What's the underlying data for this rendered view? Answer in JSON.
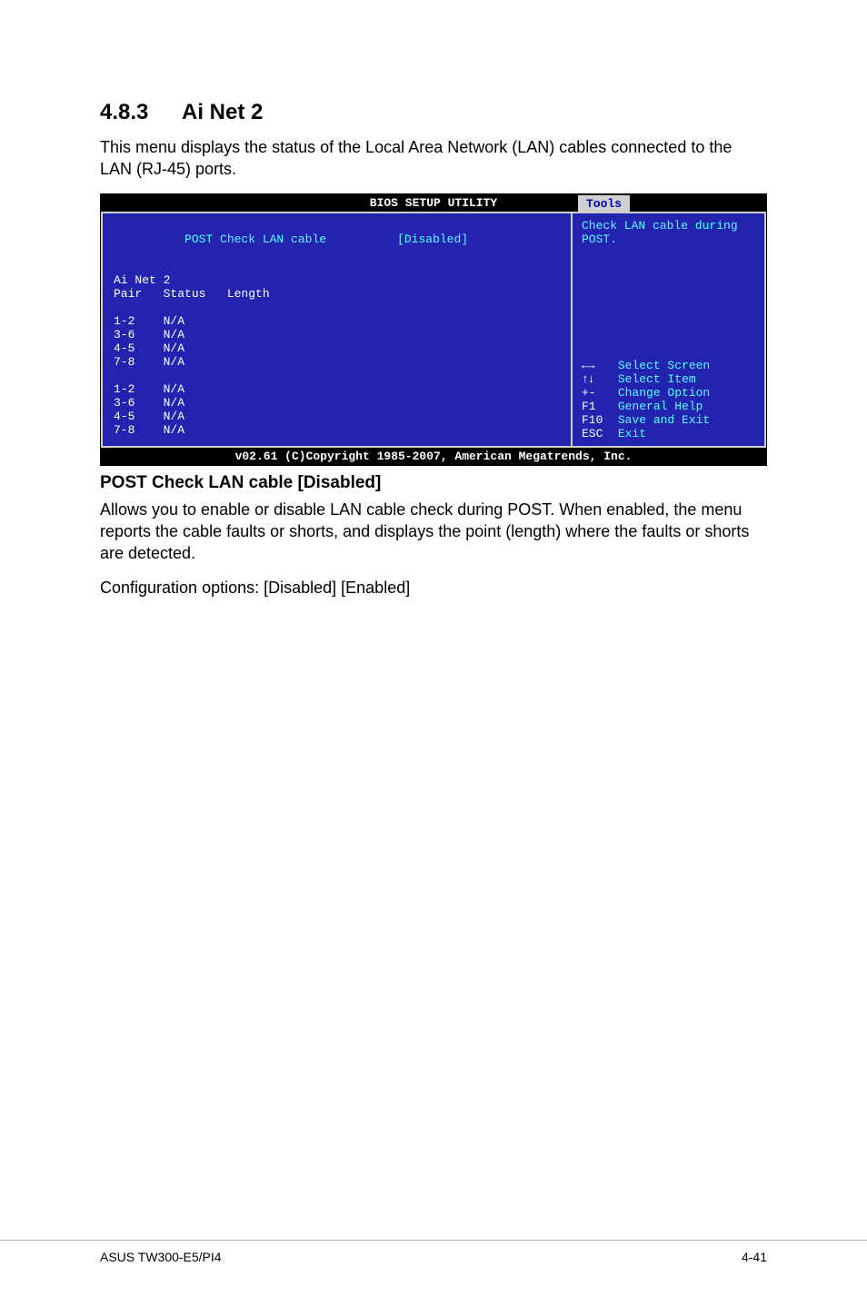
{
  "section": {
    "number": "4.8.3",
    "title": "Ai Net 2"
  },
  "intro": "This menu displays the status of the Local Area Network (LAN) cables connected to the LAN (RJ-45) ports.",
  "bios": {
    "title": "BIOS SETUP UTILITY",
    "tab": "Tools",
    "left": {
      "setting_label": "POST Check LAN cable",
      "setting_value": "[Disabled]",
      "group_title": "Ai Net 2",
      "columns": "Pair   Status   Length",
      "rows1": [
        "1-2    N/A",
        "3-6    N/A",
        "4-5    N/A",
        "7-8    N/A"
      ],
      "rows2": [
        "1-2    N/A",
        "3-6    N/A",
        "4-5    N/A",
        "7-8    N/A"
      ]
    },
    "right": {
      "help_top": "Check LAN cable during POST.",
      "keys": [
        {
          "key": "←→",
          "label": "Select Screen"
        },
        {
          "key": "↑↓",
          "label": "Select Item"
        },
        {
          "key": "+-",
          "label": "Change Option"
        },
        {
          "key": "F1",
          "label": "General Help"
        },
        {
          "key": "F10",
          "label": "Save and Exit"
        },
        {
          "key": "ESC",
          "label": "Exit"
        }
      ]
    },
    "footer": "v02.61 (C)Copyright 1985-2007, American Megatrends, Inc."
  },
  "post_check": {
    "heading": "POST Check LAN cable [Disabled]",
    "p1": "Allows you to enable or disable LAN cable check during POST. When enabled, the menu reports the cable faults or shorts, and displays the point (length) where the faults or shorts are detected.",
    "p2": "Configuration options: [Disabled] [Enabled]"
  },
  "footer": {
    "left": "ASUS TW300-E5/PI4",
    "right": "4-41"
  }
}
